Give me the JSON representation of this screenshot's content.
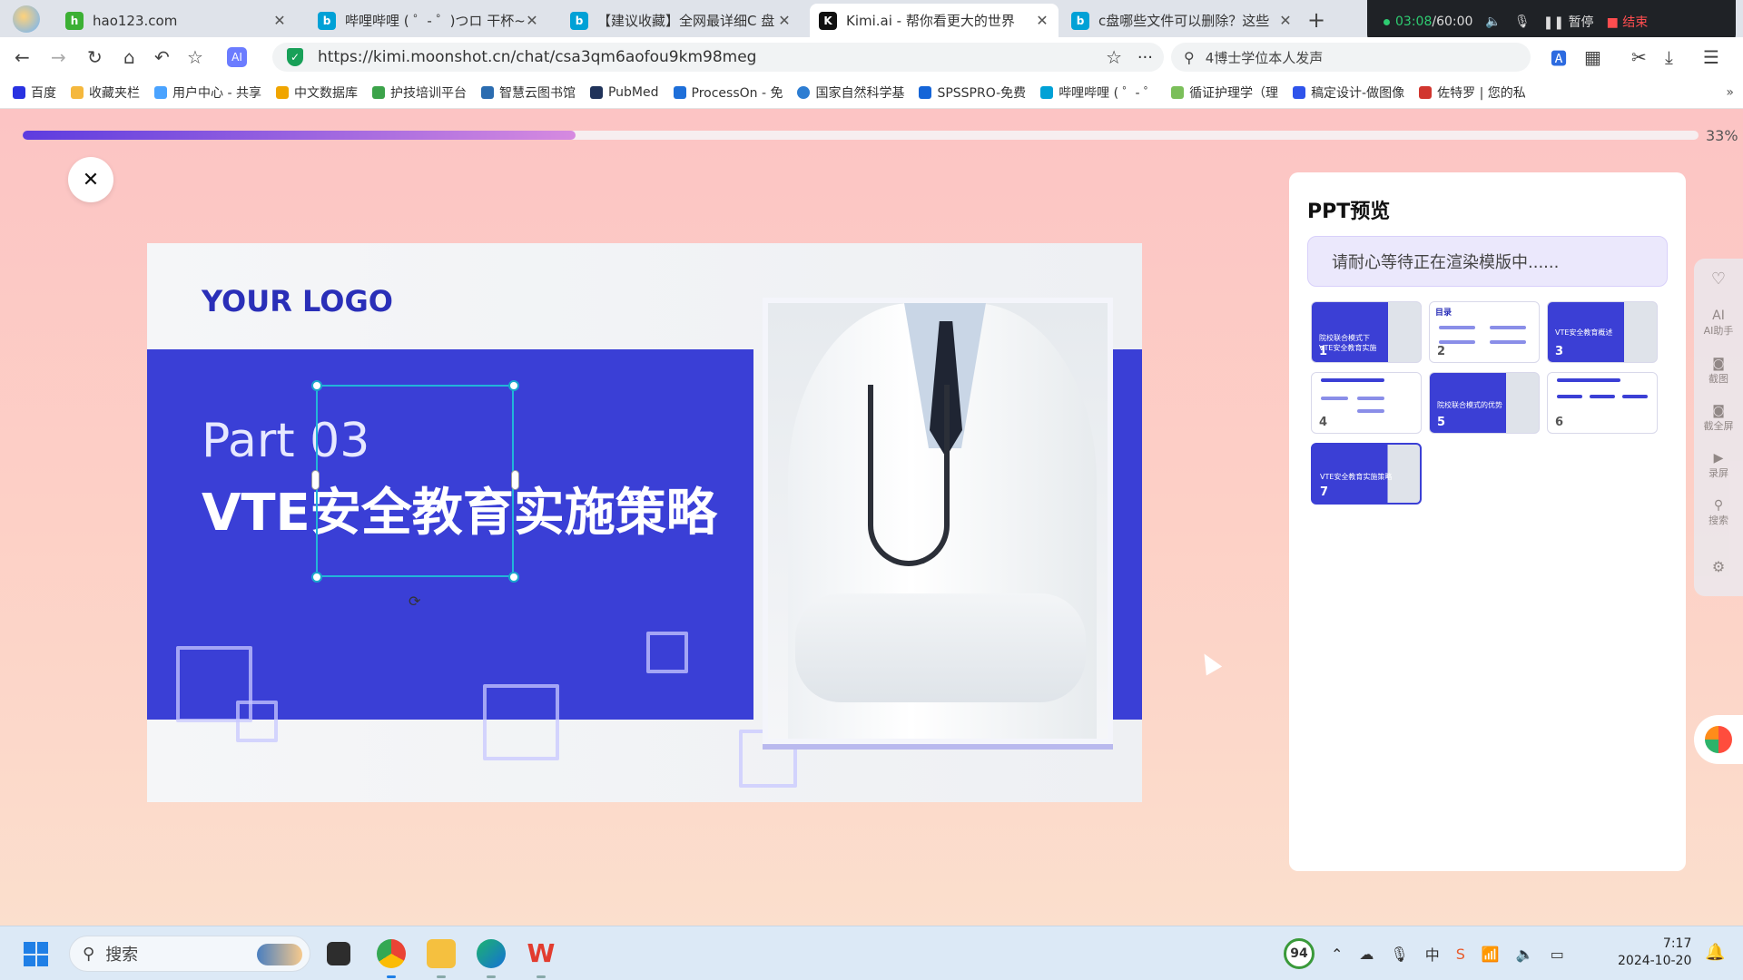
{
  "browser": {
    "tabs": [
      {
        "title": "hao123.com",
        "icon": "hao123-icon",
        "color": "#3cb034"
      },
      {
        "title": "哔哩哔哩 ( ゜- ゜)つロ 干杯~-",
        "icon": "bilibili-icon",
        "color": "#00a1d6"
      },
      {
        "title": "【建议收藏】全网最详细C 盘",
        "icon": "bilibili-icon",
        "color": "#00a1d6"
      },
      {
        "title": "Kimi.ai - 帮你看更大的世界",
        "icon": "kimi-icon",
        "color": "#111111",
        "active": true
      },
      {
        "title": "c盘哪些文件可以删除？这些",
        "icon": "bilibili-icon",
        "color": "#00a1d6"
      }
    ],
    "recorder": {
      "time": "03:08",
      "total": "/60:00",
      "pause": "暂停",
      "end": "结束"
    },
    "url": "https://kimi.moonshot.cn/chat/csa3qm6aofou9km98meg",
    "search_text": "4博士学位本人发声",
    "bookmarks": [
      "百度",
      "收藏夹栏",
      "用户中心 - 共享",
      "中文数据库",
      "护技培训平台",
      "智慧云图书馆",
      "PubMed",
      "ProcessOn - 免",
      "国家自然科学基",
      "SPSSPRO-免费",
      "哔哩哔哩 ( ゜- ゜",
      "循证护理学（理",
      "稿定设计-做图像",
      "佐特罗 | 您的私"
    ]
  },
  "progress": {
    "percent": 33,
    "label": "33%"
  },
  "slide": {
    "logo": "YOUR LOGO",
    "part": "Part  03",
    "title": "VTE安全教育实施策略"
  },
  "ppt_preview": {
    "title": "PPT预览",
    "status": "请耐心等待正在渲染模版中......",
    "thumbnails": [
      {
        "number": "1",
        "style": "blue",
        "text": "院校联合模式下VTE安全教育实施"
      },
      {
        "number": "2",
        "style": "white",
        "text": "目录"
      },
      {
        "number": "3",
        "style": "blue",
        "text": "VTE安全教育概述"
      },
      {
        "number": "4",
        "style": "white",
        "text": ""
      },
      {
        "number": "5",
        "style": "blue",
        "text": "院校联合模式的优势"
      },
      {
        "number": "6",
        "style": "white",
        "text": ""
      },
      {
        "number": "7",
        "style": "blue",
        "text": "VTE安全教育实施策略",
        "selected": true
      }
    ]
  },
  "side_toolbar": [
    "AI助手",
    "截图",
    "截全屏",
    "录屏",
    "搜索"
  ],
  "taskbar": {
    "search_placeholder": "搜索",
    "badge": "94",
    "ime": "中",
    "time": "7:17",
    "date": "2024-10-20"
  },
  "colors": {
    "accent": "#3a3fd6",
    "progress_start": "#5d3cdf",
    "progress_end": "#d68ae0",
    "recording": "#2ecc71",
    "end": "#ff4d4f"
  }
}
